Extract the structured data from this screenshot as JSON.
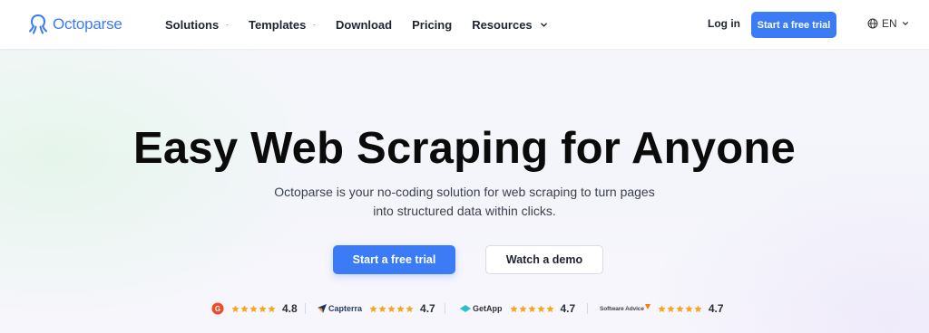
{
  "header": {
    "logo_text": "Octoparse",
    "nav": [
      {
        "label": "Solutions",
        "has_dropdown": true
      },
      {
        "label": "Templates",
        "has_dropdown": true
      },
      {
        "label": "Download",
        "has_dropdown": false
      },
      {
        "label": "Pricing",
        "has_dropdown": false
      },
      {
        "label": "Resources",
        "has_dropdown": true
      }
    ],
    "login_label": "Log in",
    "trial_label": "Start a free trial",
    "language": "EN"
  },
  "hero": {
    "title": "Easy Web Scraping for Anyone",
    "subtitle_line1": "Octoparse is your no-coding solution for web scraping to turn pages",
    "subtitle_line2": "into structured data within clicks.",
    "primary_cta": "Start a free trial",
    "secondary_cta": "Watch a demo"
  },
  "ratings": [
    {
      "brand": "G2",
      "brand_text": "",
      "score": "4.8",
      "stars": 5
    },
    {
      "brand": "Capterra",
      "brand_text": "Capterra",
      "score": "4.7",
      "stars": 5
    },
    {
      "brand": "GetApp",
      "brand_text": "GetApp",
      "score": "4.7",
      "stars": 5
    },
    {
      "brand": "Software Advice",
      "brand_text": "Software Advice",
      "score": "4.7",
      "stars": 5
    }
  ],
  "colors": {
    "accent": "#3b7bf6",
    "star": "#f5a623",
    "g2": "#ef4a2a"
  },
  "icons": [
    "octopus-logo-icon",
    "chevron-down-icon",
    "globe-icon",
    "star-icon",
    "g2-logo-icon",
    "capterra-logo-icon",
    "getapp-logo-icon",
    "software-advice-logo-icon"
  ]
}
